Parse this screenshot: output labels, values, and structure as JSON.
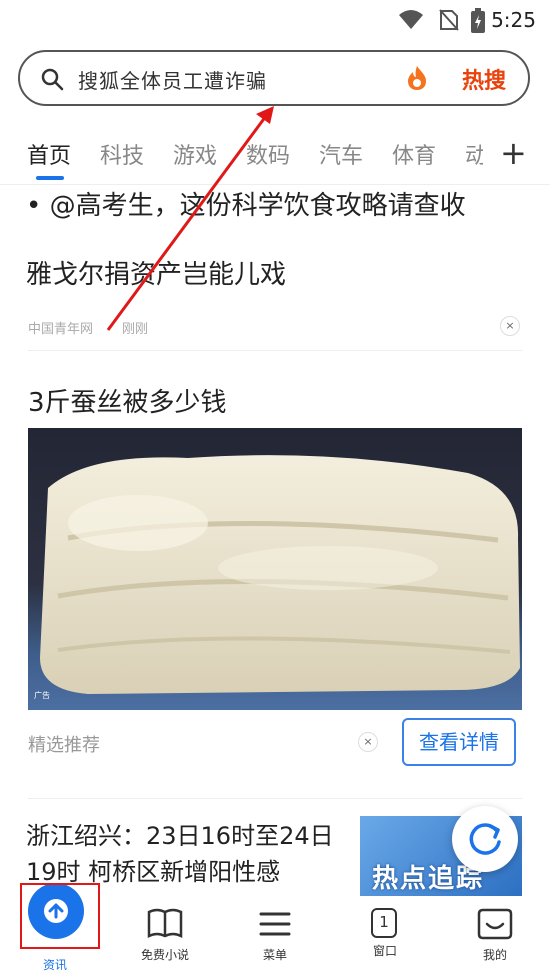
{
  "status_bar": {
    "time": "5:25"
  },
  "search": {
    "query": "搜狐全体员工遭诈骗",
    "hot_label": "热搜"
  },
  "tabs": [
    {
      "label": "首页"
    },
    {
      "label": "科技"
    },
    {
      "label": "游戏"
    },
    {
      "label": "数码"
    },
    {
      "label": "汽车"
    },
    {
      "label": "体育"
    },
    {
      "label": "动"
    }
  ],
  "tab_add": "+",
  "feed": {
    "item1": {
      "title": "• @高考生，这份科学饮食攻略请查收"
    },
    "item2": {
      "title": "雅戈尔捐资产岂能儿戏",
      "source": "中国青年网",
      "time": "刚刚",
      "close": "×"
    },
    "item3": {
      "title": "3斤蚕丝被多少钱",
      "ad_mark": "广告",
      "tag": "精选推荐",
      "close": "×",
      "button": "查看详情"
    },
    "item4": {
      "title": "浙江绍兴：23日16时至24日19时 柯桥区新增阳性感",
      "thumb_text": "热点追踪"
    }
  },
  "bottom_nav": [
    {
      "label": "资讯"
    },
    {
      "label": "免费小说"
    },
    {
      "label": "菜单"
    },
    {
      "label": "窗口",
      "count": "1"
    },
    {
      "label": "我的"
    }
  ],
  "colors": {
    "accent": "#1a73e8",
    "hot": "#e8430c",
    "highlight_box": "#e01818",
    "arrow": "#e01818"
  }
}
